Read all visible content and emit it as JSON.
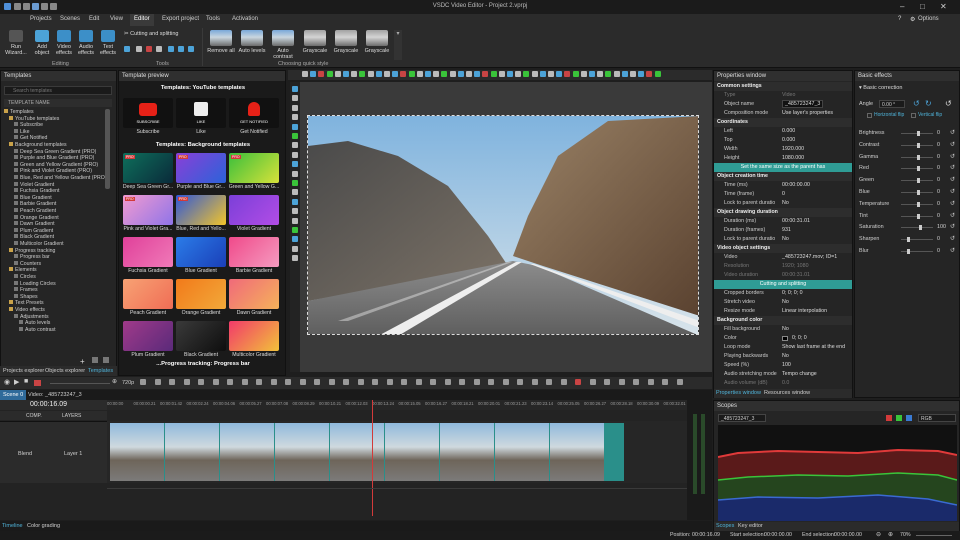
{
  "app": {
    "title": "VSDC Video Editor - Project 2.vprpj",
    "options": "Options"
  },
  "colors": {
    "accent": "#2f9c95",
    "timeline_clip": "#2a8f8a",
    "playhead": "#d23a3a",
    "bg": "#1e1e1e"
  },
  "menu": [
    "Projects",
    "Scenes",
    "Edit",
    "View",
    "Editor",
    "Export project",
    "Tools",
    "Activation"
  ],
  "menu_active_index": 4,
  "ribbon": {
    "run": "Run Wizard...",
    "add": "Add object",
    "video_effects": "Video effects",
    "audio_effects": "Audio effects",
    "text_effects": "Text effects",
    "cutting": "Cutting and splitting",
    "group_editing": "Editing",
    "group_tools": "Tools",
    "group_quick": "Choosing quick style",
    "quick": [
      "Remove all",
      "Auto levels",
      "Auto contrast",
      "Grayscale",
      "Grayscale",
      "Grayscale"
    ]
  },
  "left_panel": {
    "title": "Templates",
    "search_placeholder": "Search templates",
    "column": "TEMPLATE NAME",
    "tree": [
      "Templates",
      "YouTube templates",
      "Subscribe",
      "Like",
      "Get Notified",
      "Background templates",
      "Deep Sea Green Gradient (PRO)",
      "Purple and Blue Gradient (PRO)",
      "Green and Yellow Gradient (PRO)",
      "Pink and Violet Gradient (PRO)",
      "Blue, Red and Yellow Gradient (PRO)",
      "Violet Gradient",
      "Fuchsia Gradient",
      "Blue Gradient",
      "Barbie Gradient",
      "Peach Gradient",
      "Orange Gradient",
      "Dawn Gradient",
      "Plum Gradient",
      "Black Gradient",
      "Multicolor Gradient",
      "Progress tracking",
      "Progress bar",
      "Counters",
      "Elements",
      "Circles",
      "Loading Circles",
      "Frames",
      "Shapes",
      "Text Presets",
      "Video effects",
      "Adjustments",
      "Auto levels",
      "Auto contrast"
    ],
    "tabs": [
      "Projects explorer",
      "Objects explorer",
      "Templates"
    ]
  },
  "template_preview": {
    "title": "Template preview",
    "yt_header": "Templates: YouTube templates",
    "yt": [
      {
        "label": "Subscribe",
        "badge": "SUBSCRIBE"
      },
      {
        "label": "Like",
        "badge": "LIKE"
      },
      {
        "label": "Get Notified",
        "badge": "GET NOTIFIED"
      }
    ],
    "bg_header": "Templates: Background templates",
    "bg": [
      {
        "label": "Deep Sea Green Gr...",
        "pro": "PRO",
        "c1": "#0e6f5b",
        "c2": "#0a2a3a"
      },
      {
        "label": "Purple and Blue Gr...",
        "pro": "PRO",
        "c1": "#8a3fd8",
        "c2": "#2b63d9"
      },
      {
        "label": "Green and Yellow G...",
        "pro": "PRO",
        "c1": "#3bbf3b",
        "c2": "#d8e23a"
      },
      {
        "label": "Pink and Violet Gra...",
        "pro": "PRO",
        "c1": "#f29bd0",
        "c2": "#8f74e8"
      },
      {
        "label": "Blue, Red and Yello...",
        "pro": "PRO",
        "c1": "#3057d8",
        "c2": "#f2c52a"
      },
      {
        "label": "Violet Gradient",
        "pro": "",
        "c1": "#7b3fd8",
        "c2": "#b24de6"
      },
      {
        "label": "Fuchsia Gradient",
        "pro": "",
        "c1": "#e0409a",
        "c2": "#f07ab8"
      },
      {
        "label": "Blue Gradient",
        "pro": "",
        "c1": "#2b7ce8",
        "c2": "#1a3fb8"
      },
      {
        "label": "Barbie Gradient",
        "pro": "",
        "c1": "#f04a8a",
        "c2": "#f59bc0"
      },
      {
        "label": "Peach Gradient",
        "pro": "",
        "c1": "#f7a274",
        "c2": "#f06d55"
      },
      {
        "label": "Orange Gradient",
        "pro": "",
        "c1": "#f27a1a",
        "c2": "#f2a93a"
      },
      {
        "label": "Dawn Gradient",
        "pro": "",
        "c1": "#f06a7a",
        "c2": "#f5b25a"
      },
      {
        "label": "Plum Gradient",
        "pro": "",
        "c1": "#a03a8a",
        "c2": "#5a2a7a"
      },
      {
        "label": "Black Gradient",
        "pro": "",
        "c1": "#3a3a3a",
        "c2": "#0e0e0e"
      },
      {
        "label": "Multicolor Gradient",
        "pro": "",
        "c1": "#f23a6a",
        "c2": "#f2c23a"
      }
    ],
    "footer": "...Progress tracking: Progress bar"
  },
  "properties": {
    "title": "Properties window",
    "rows": [
      {
        "k": "Common settings",
        "v": "",
        "t": "sec"
      },
      {
        "k": "Type",
        "v": "Video",
        "t": "dim"
      },
      {
        "k": "Object name",
        "v": "_485723247_3",
        "t": "box"
      },
      {
        "k": "Composition mode",
        "v": "Use layer's properties",
        "t": ""
      },
      {
        "k": "Coordinates",
        "v": "",
        "t": "sec"
      },
      {
        "k": "Left",
        "v": "0.000",
        "t": ""
      },
      {
        "k": "Top",
        "v": "0.000",
        "t": ""
      },
      {
        "k": "Width",
        "v": "1920.000",
        "t": ""
      },
      {
        "k": "Height",
        "v": "1080.000",
        "t": ""
      },
      {
        "k": "",
        "v": "Set the same size as the parent has",
        "t": "teal"
      },
      {
        "k": "Object creation time",
        "v": "",
        "t": "sec"
      },
      {
        "k": "Time (ms)",
        "v": "00:00:00.00",
        "t": ""
      },
      {
        "k": "Time (frame)",
        "v": "0",
        "t": ""
      },
      {
        "k": "Lock to parent duratio",
        "v": "No",
        "t": ""
      },
      {
        "k": "Object drawing duration",
        "v": "",
        "t": "sec"
      },
      {
        "k": "Duration (ms)",
        "v": "00:00:31.01",
        "t": ""
      },
      {
        "k": "Duration (frames)",
        "v": "931",
        "t": ""
      },
      {
        "k": "Lock to parent duratio",
        "v": "No",
        "t": ""
      },
      {
        "k": "Video object settings",
        "v": "",
        "t": "sec"
      },
      {
        "k": "Video",
        "v": "_485723247.mov; ID=1",
        "t": ""
      },
      {
        "k": "Resolution",
        "v": "1920; 1080",
        "t": "dim"
      },
      {
        "k": "Video duration",
        "v": "00:00:31.01",
        "t": "dim"
      },
      {
        "k": "",
        "v": "Cutting and splitting",
        "t": "teal"
      },
      {
        "k": "Cropped borders",
        "v": "0; 0; 0; 0",
        "t": ""
      },
      {
        "k": "Stretch video",
        "v": "No",
        "t": ""
      },
      {
        "k": "Resize mode",
        "v": "Linear interpolation",
        "t": ""
      },
      {
        "k": "Background color",
        "v": "",
        "t": "sec"
      },
      {
        "k": "Fill background",
        "v": "No",
        "t": ""
      },
      {
        "k": "Color",
        "v": "0; 0; 0",
        "t": "color"
      },
      {
        "k": "Loop mode",
        "v": "Show last frame at the end",
        "t": ""
      },
      {
        "k": "Playing backwards",
        "v": "No",
        "t": ""
      },
      {
        "k": "Speed (%)",
        "v": "100",
        "t": ""
      },
      {
        "k": "Audio stretching mode",
        "v": "Tempo change",
        "t": ""
      },
      {
        "k": "Audio volume (dB)",
        "v": "0.0",
        "t": "dim"
      }
    ],
    "tabs": [
      "Properties window",
      "Resources window"
    ]
  },
  "effects": {
    "title": "Basic effects",
    "section": "Basic correction",
    "angle_label": "Angle",
    "angle_value": "0.00 °",
    "hflip": "Horizontal flip",
    "vflip": "Vertical flip",
    "rows": [
      {
        "k": "Brightness",
        "v": "0",
        "pos": 0.5
      },
      {
        "k": "Contrast",
        "v": "0",
        "pos": 0.5
      },
      {
        "k": "Gamma",
        "v": "0",
        "pos": 0.5
      },
      {
        "k": "Red",
        "v": "0",
        "pos": 0.5
      },
      {
        "k": "Green",
        "v": "0",
        "pos": 0.5
      },
      {
        "k": "Blue",
        "v": "0",
        "pos": 0.5
      },
      {
        "k": "Temperature",
        "v": "0",
        "pos": 0.5
      },
      {
        "k": "Tint",
        "v": "0",
        "pos": 0.5
      },
      {
        "k": "Saturation",
        "v": "100",
        "pos": 0.55
      },
      {
        "k": "Sharpen",
        "v": "0",
        "pos": 0.2
      },
      {
        "k": "Blur",
        "v": "0",
        "pos": 0.2
      }
    ]
  },
  "player": {
    "quality": "720p"
  },
  "timeline": {
    "tabs": [
      "Scene 0",
      "Video: _485723247_3"
    ],
    "time": "00:00:16.09",
    "ruler": [
      "00:00:00",
      "00:00:00.21",
      "00:00:01.42",
      "00:00:02.24",
      "00:00:04.06",
      "00:00:05.27",
      "00:00:07.08",
      "00:00:08.29",
      "00:00:10.21",
      "00:00:12.03",
      "00:00:13.24",
      "00:00:15.05",
      "00:00:16.27",
      "00:00:18.21",
      "00:00:20.01",
      "00:00:21.23",
      "00:00:23.14",
      "00:00:25.05",
      "00:00:26.27",
      "00:00:28.18",
      "00:00:30.09",
      "00:00:32.01"
    ],
    "col_comp": "COMP.",
    "col_layers": "LAYERS",
    "blend": "Blend",
    "layer": "Layer 1",
    "bottom_tabs": [
      "Timeline",
      "Color grading"
    ],
    "playhead_frac": 0.51
  },
  "scopes": {
    "title": "Scopes",
    "clip": "_485723247_3",
    "mode": "RGB",
    "tabs": [
      "Scopes",
      "Key editor"
    ]
  },
  "status": {
    "position": "Position:",
    "position_v": "00:00:16.09",
    "start_sel": "Start selection:",
    "start_v": "00:00:00.00",
    "end_sel": "End selection:",
    "end_v": "00:00:00.00",
    "zoom": "70%"
  }
}
